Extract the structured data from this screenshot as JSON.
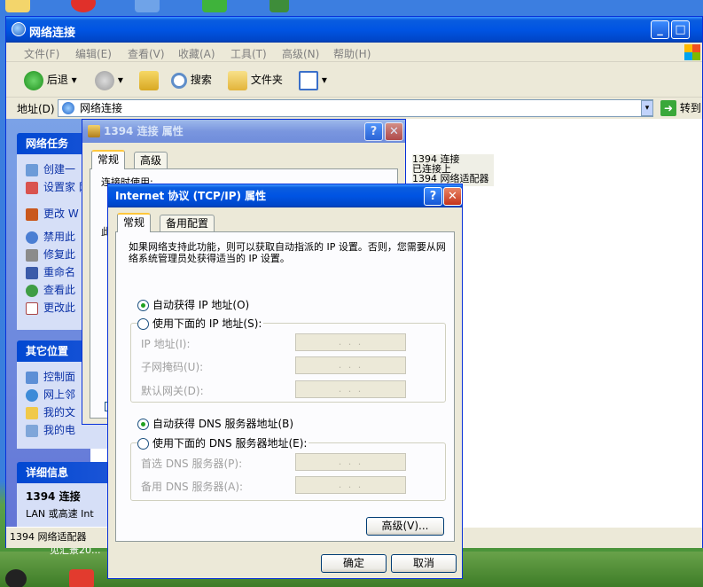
{
  "window": {
    "title": "网络连接",
    "menu": [
      "文件(F)",
      "编辑(E)",
      "查看(V)",
      "收藏(A)",
      "工具(T)",
      "高级(N)",
      "帮助(H)"
    ],
    "toolbar": {
      "back": "后退",
      "search": "搜索",
      "folders": "文件夹"
    },
    "address": {
      "label": "地址(D)",
      "value": "网络连接",
      "go": "转到"
    },
    "status": "1394 网络适配器"
  },
  "sidebar": {
    "network_tasks": {
      "title": "网络任务",
      "items": [
        "创建一",
        "设置家 网络",
        "更改 W 墙设置",
        "禁用此",
        "修复此",
        "重命名",
        "查看此",
        "更改此"
      ]
    },
    "other_places": {
      "title": "其它位置",
      "items": [
        "控制面",
        "网上邻",
        "我的文",
        "我的电"
      ]
    },
    "details": {
      "title": "详细信息",
      "name": "1394 连接",
      "type": "LAN 或高速 Int"
    }
  },
  "connection_item": {
    "name": "1394 连接",
    "status": "已连接上",
    "device": "1394 网络适配器"
  },
  "props_dialog": {
    "title": "1394 连接 属性",
    "tabs": [
      "常规",
      "高级"
    ],
    "connect_using": "连接时使用:",
    "partial_label": "此"
  },
  "tcpip_dialog": {
    "title": "Internet 协议 (TCP/IP) 属性",
    "tabs": [
      "常规",
      "备用配置"
    ],
    "description": "如果网络支持此功能，则可以获取自动指派的 IP 设置。否则，您需要从网络系统管理员处获得适当的 IP 设置。",
    "ip_auto": "自动获得 IP 地址(O)",
    "ip_manual": "使用下面的 IP 地址(S):",
    "ip_fields": [
      "IP 地址(I):",
      "子网掩码(U):",
      "默认网关(D):"
    ],
    "dns_auto": "自动获得 DNS 服务器地址(B)",
    "dns_manual": "使用下面的 DNS 服务器地址(E):",
    "dns_fields": [
      "首选 DNS 服务器(P):",
      "备用 DNS 服务器(A):"
    ],
    "ip_placeholder": ".   .   .",
    "advanced": "高级(V)...",
    "ok": "确定",
    "cancel": "取消",
    "help_btn": "?",
    "close_btn": "✕"
  },
  "desktop": {
    "bottom_text": "见汇景20..."
  },
  "colors": {
    "xp_blue": "#0054e3",
    "radio_dot": "#21a121",
    "link": "#0b31a6"
  }
}
